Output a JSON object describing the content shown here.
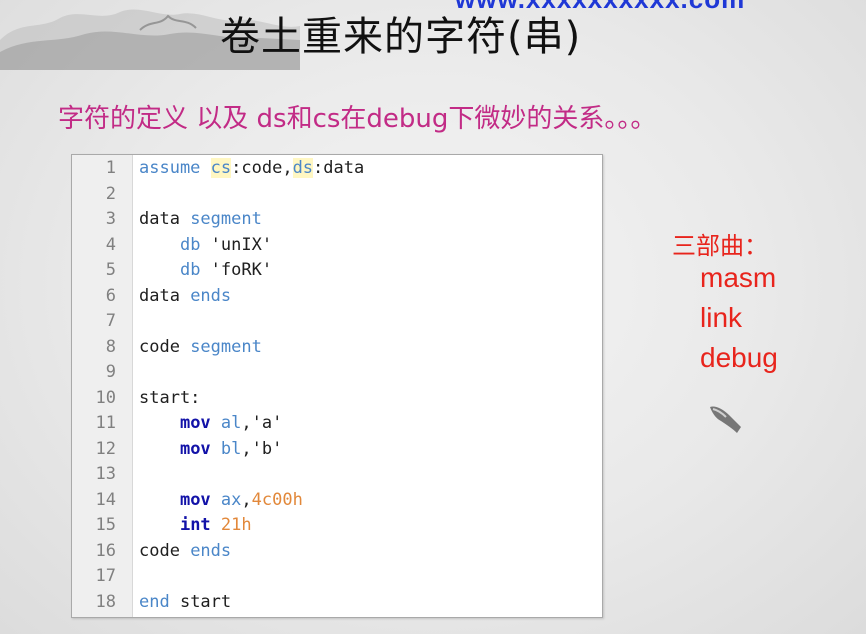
{
  "url_fragment": "www.xxxxxxxxxx.com",
  "title": "卷土重来的字符(串)",
  "subtitle": "字符的定义 以及 ds和cs在debug下微妙的关系。。。",
  "colors": {
    "subtitle": "#c22b86",
    "notes": "#e8241c",
    "keyword": "#4a86c8",
    "number": "#e2883a",
    "instruction": "#1212a8"
  },
  "code_editor": {
    "lines": [
      {
        "n": "1",
        "tokens": [
          {
            "t": "assume ",
            "c": "kw"
          },
          {
            "t": "cs",
            "c": "reg"
          },
          {
            "t": ":code,",
            "c": "plain"
          },
          {
            "t": "ds",
            "c": "reg"
          },
          {
            "t": ":data",
            "c": "plain"
          }
        ]
      },
      {
        "n": "2",
        "tokens": []
      },
      {
        "n": "3",
        "tokens": [
          {
            "t": "data ",
            "c": "plain"
          },
          {
            "t": "segment",
            "c": "kw"
          }
        ]
      },
      {
        "n": "4",
        "tokens": [
          {
            "t": "    ",
            "c": "plain"
          },
          {
            "t": "db",
            "c": "kw"
          },
          {
            "t": " 'unIX'",
            "c": "str"
          }
        ]
      },
      {
        "n": "5",
        "tokens": [
          {
            "t": "    ",
            "c": "plain"
          },
          {
            "t": "db",
            "c": "kw"
          },
          {
            "t": " 'foRK'",
            "c": "str"
          }
        ]
      },
      {
        "n": "6",
        "tokens": [
          {
            "t": "data ",
            "c": "plain"
          },
          {
            "t": "ends",
            "c": "kw"
          }
        ]
      },
      {
        "n": "7",
        "tokens": []
      },
      {
        "n": "8",
        "tokens": [
          {
            "t": "code ",
            "c": "plain"
          },
          {
            "t": "segment",
            "c": "kw"
          }
        ]
      },
      {
        "n": "9",
        "tokens": []
      },
      {
        "n": "10",
        "tokens": [
          {
            "t": "start:",
            "c": "plain"
          }
        ]
      },
      {
        "n": "11",
        "tokens": [
          {
            "t": "    ",
            "c": "plain"
          },
          {
            "t": "mov",
            "c": "op"
          },
          {
            "t": " ",
            "c": "plain"
          },
          {
            "t": "al",
            "c": "kw"
          },
          {
            "t": ",'a'",
            "c": "str"
          }
        ]
      },
      {
        "n": "12",
        "tokens": [
          {
            "t": "    ",
            "c": "plain"
          },
          {
            "t": "mov",
            "c": "op"
          },
          {
            "t": " ",
            "c": "plain"
          },
          {
            "t": "bl",
            "c": "kw"
          },
          {
            "t": ",'b'",
            "c": "str"
          }
        ]
      },
      {
        "n": "13",
        "tokens": []
      },
      {
        "n": "14",
        "tokens": [
          {
            "t": "    ",
            "c": "plain"
          },
          {
            "t": "mov",
            "c": "op"
          },
          {
            "t": " ",
            "c": "plain"
          },
          {
            "t": "ax",
            "c": "kw"
          },
          {
            "t": ",",
            "c": "plain"
          },
          {
            "t": "4c00h",
            "c": "num"
          }
        ]
      },
      {
        "n": "15",
        "tokens": [
          {
            "t": "    ",
            "c": "plain"
          },
          {
            "t": "int",
            "c": "op"
          },
          {
            "t": " ",
            "c": "plain"
          },
          {
            "t": "21h",
            "c": "num"
          }
        ]
      },
      {
        "n": "16",
        "tokens": [
          {
            "t": "code ",
            "c": "plain"
          },
          {
            "t": "ends",
            "c": "kw"
          }
        ]
      },
      {
        "n": "17",
        "tokens": []
      },
      {
        "n": "18",
        "tokens": [
          {
            "t": "end",
            "c": "kw"
          },
          {
            "t": " start",
            "c": "plain"
          }
        ]
      }
    ]
  },
  "notes": {
    "heading": "三部曲：",
    "steps": [
      "masm",
      "link",
      "debug"
    ]
  },
  "icons": {
    "landscape": "ink-landscape-painting",
    "cursor": "hand-pointer-icon"
  }
}
